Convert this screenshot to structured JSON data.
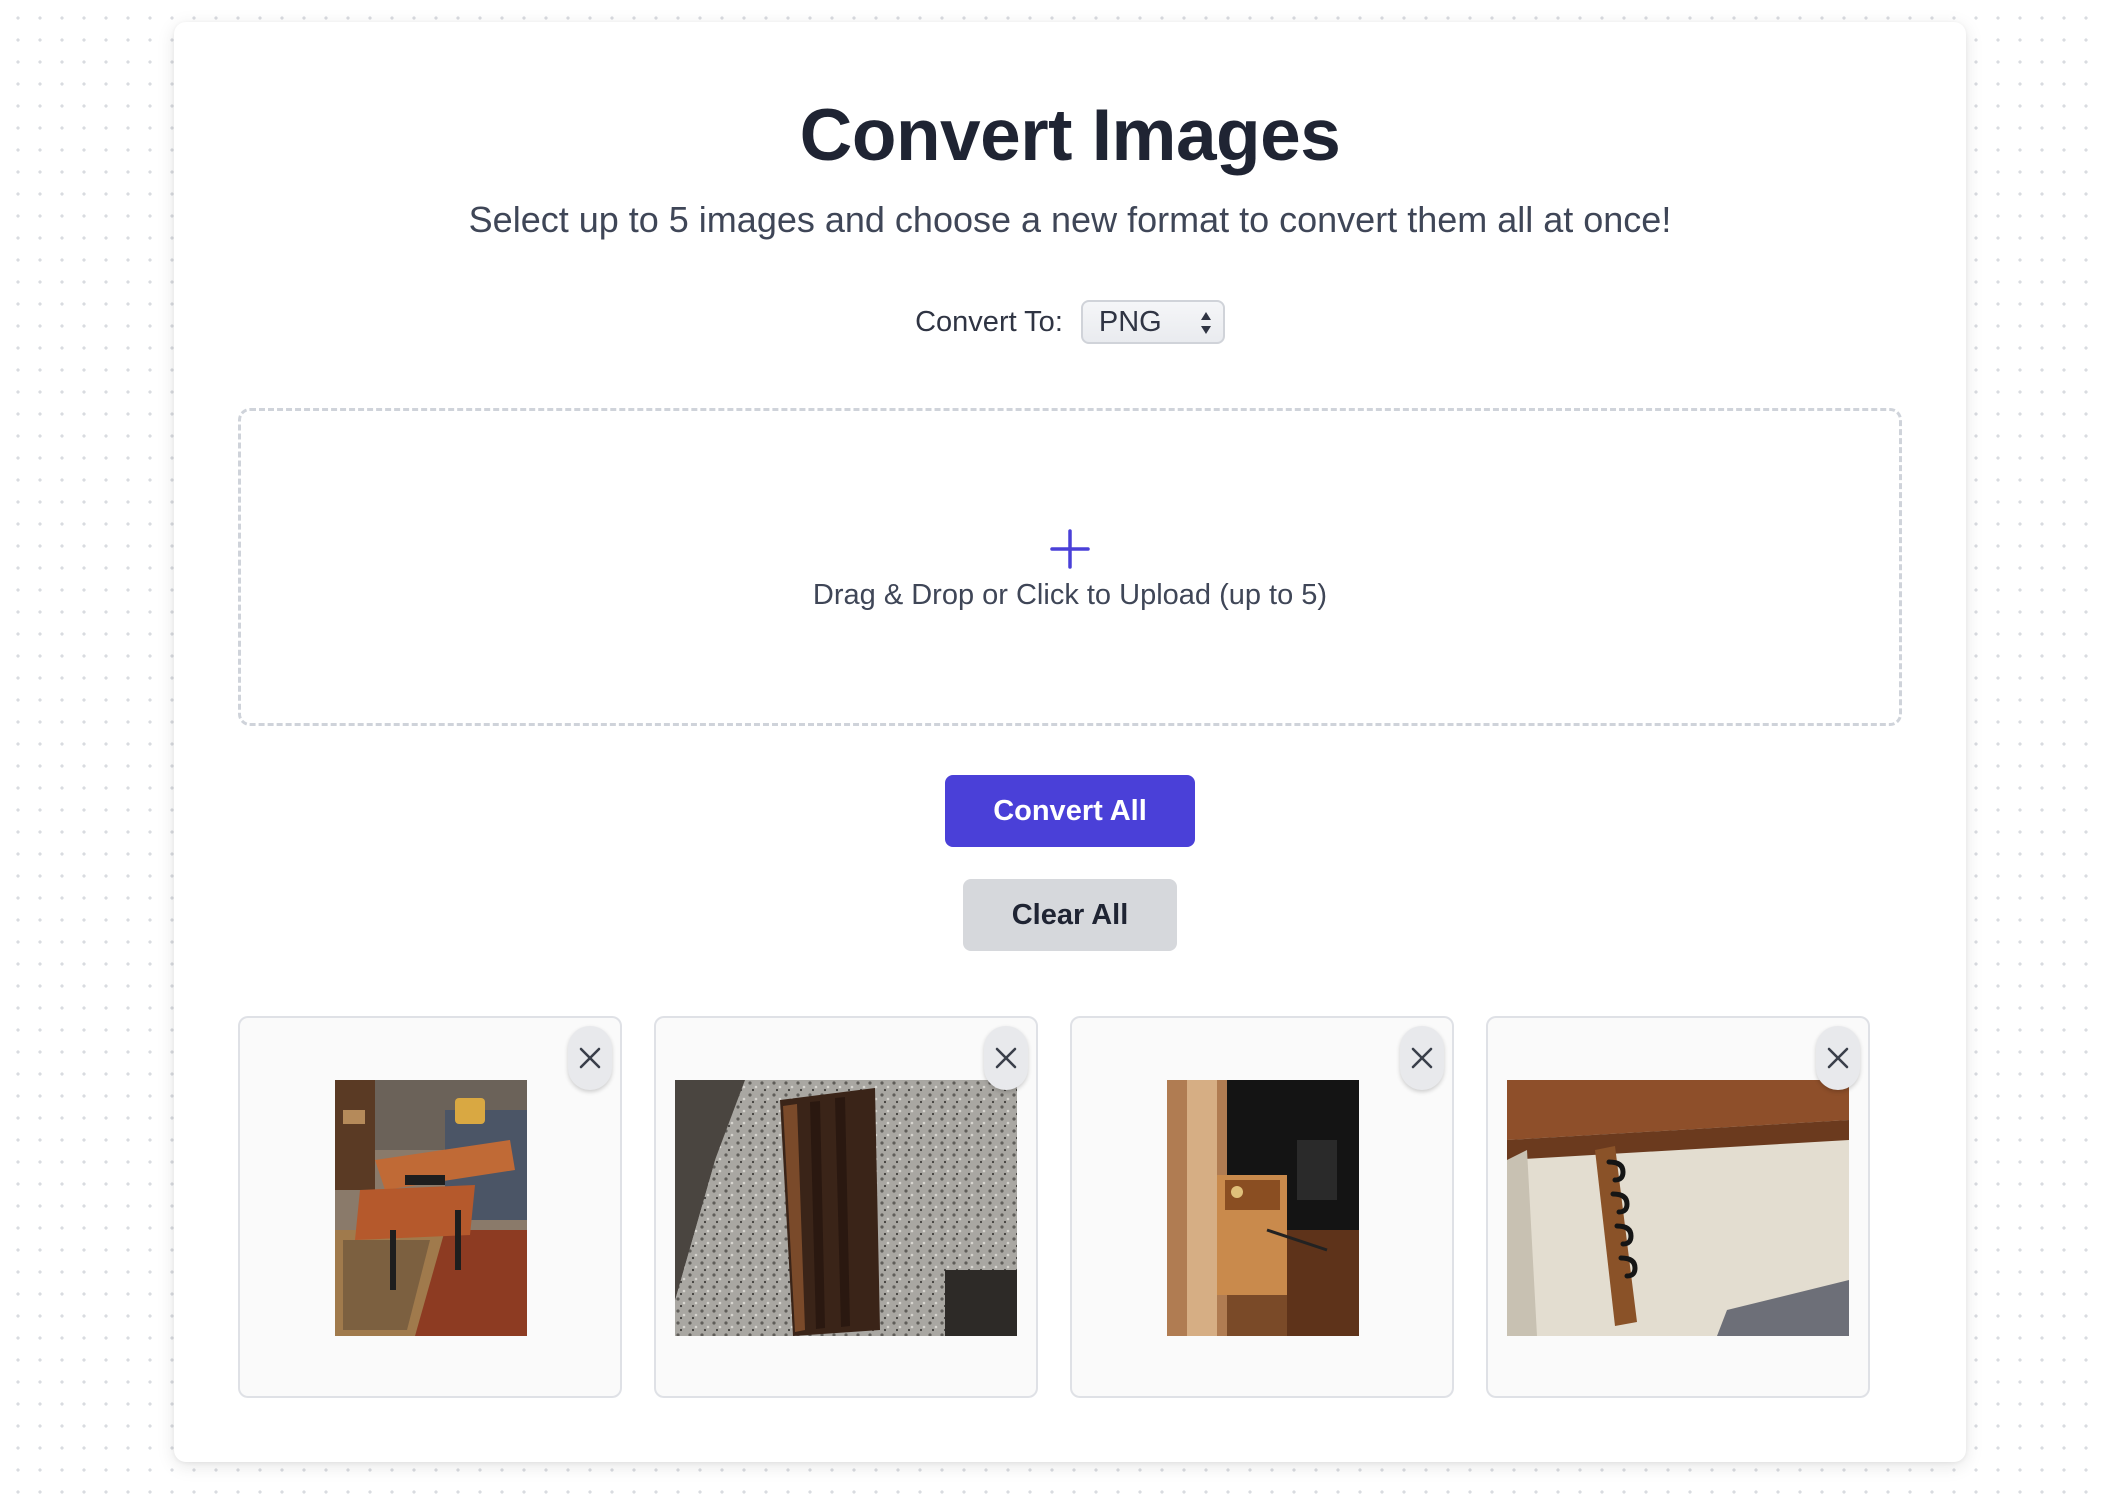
{
  "header": {
    "title": "Convert Images",
    "subtitle": "Select up to 5 images and choose a new format to convert them all at once!"
  },
  "format": {
    "label": "Convert To:",
    "selected": "PNG"
  },
  "dropzone": {
    "icon": "plus-icon",
    "text": "Drag & Drop or Click to Upload (up to 5)"
  },
  "actions": {
    "convert_label": "Convert All",
    "clear_label": "Clear All"
  },
  "images": [
    {
      "subject": "wooden lift-top coffee table in living room",
      "remove_icon": "close-icon"
    },
    {
      "subject": "dark walnut cutting board on granite counter",
      "remove_icon": "close-icon"
    },
    {
      "subject": "wooden organizer box on desk",
      "remove_icon": "close-icon"
    },
    {
      "subject": "wooden coat rack with black hooks",
      "remove_icon": "close-icon"
    }
  ],
  "colors": {
    "accent": "#4a40d8",
    "secondary_button": "#d6d8dc",
    "title_text": "#1f2433",
    "body_text": "#3f4657"
  }
}
